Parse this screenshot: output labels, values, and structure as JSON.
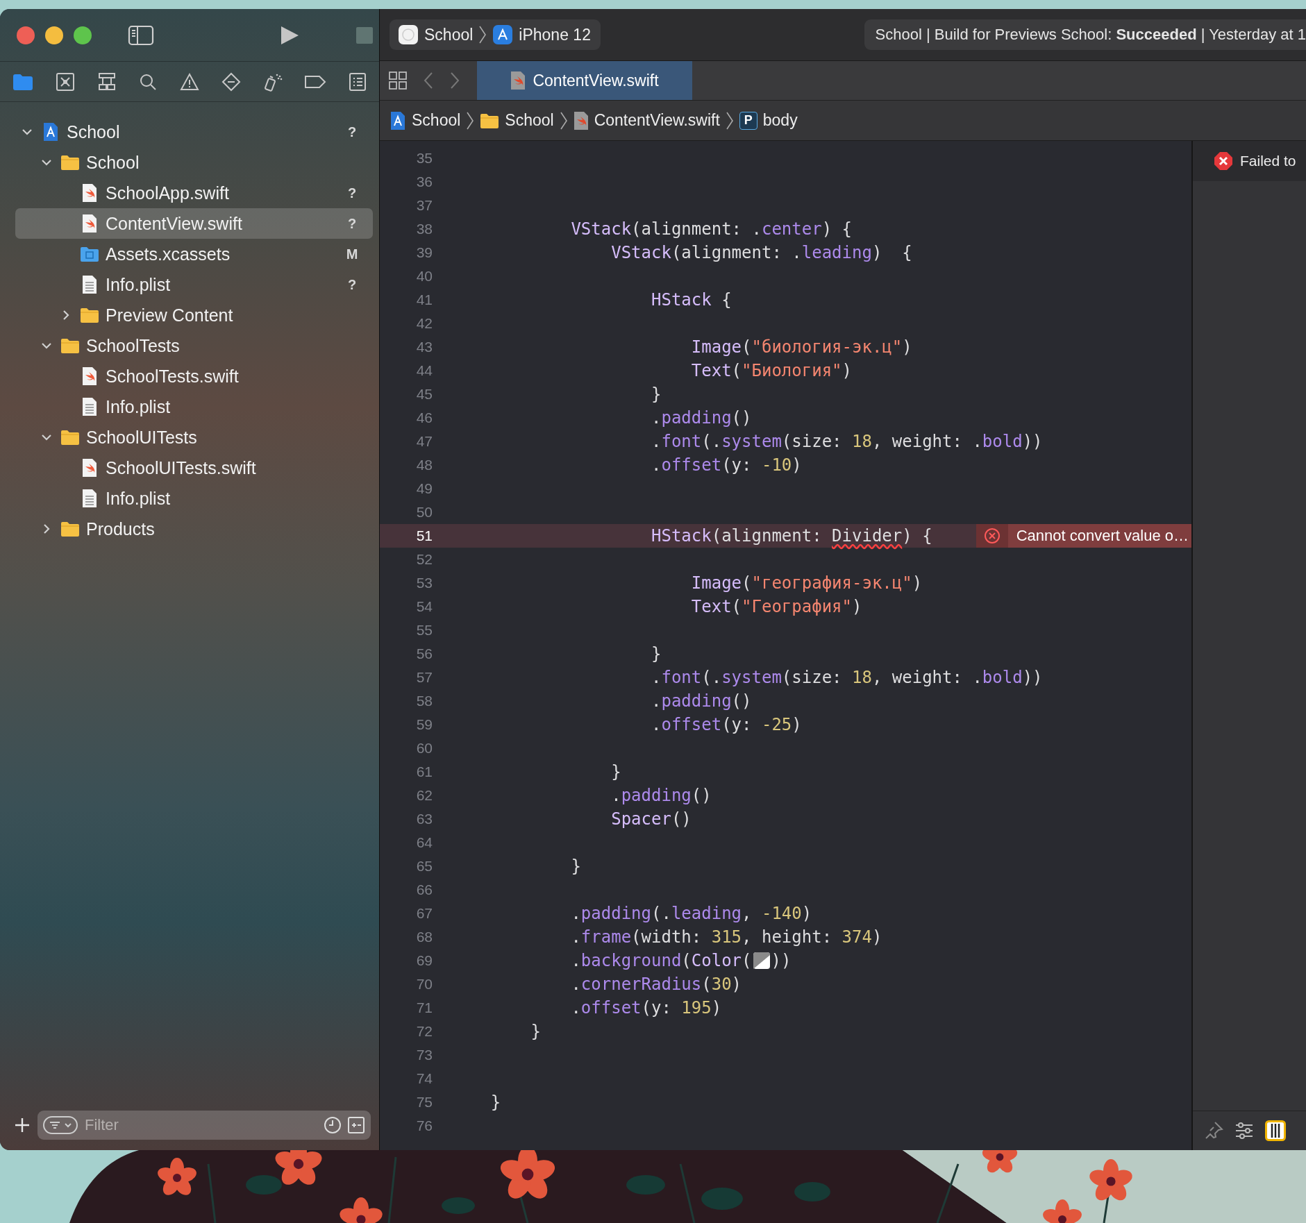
{
  "toolbar": {
    "scheme": {
      "project": "School",
      "device": "iPhone 12"
    },
    "status": "School | Build for Previews School: **Succeeded** | Yesterday at 1"
  },
  "navigator": {
    "tabs": [
      {
        "kind": "files",
        "selected": true
      },
      {
        "kind": "source_control",
        "selected": false
      },
      {
        "kind": "symbols",
        "selected": false
      },
      {
        "kind": "find",
        "selected": false
      },
      {
        "kind": "issues",
        "selected": false
      },
      {
        "kind": "tests",
        "selected": false
      },
      {
        "kind": "debug",
        "selected": false
      },
      {
        "kind": "breakpoints",
        "selected": false
      },
      {
        "kind": "reports",
        "selected": false
      }
    ],
    "tree": [
      {
        "kind": "project",
        "name": "School",
        "badge": "?",
        "expanded": true,
        "selected": false,
        "children": [
          {
            "kind": "folder",
            "name": "School",
            "expanded": true,
            "selected": false,
            "children": [
              {
                "kind": "swift",
                "name": "SchoolApp.swift",
                "badge": "?",
                "selected": false
              },
              {
                "kind": "swift",
                "name": "ContentView.swift",
                "badge": "?",
                "selected": true
              },
              {
                "kind": "assets",
                "name": "Assets.xcassets",
                "badge": "M",
                "selected": false
              },
              {
                "kind": "plist",
                "name": "Info.plist",
                "badge": "?",
                "selected": false
              },
              {
                "kind": "folder",
                "name": "Preview Content",
                "expanded": false,
                "selected": false
              }
            ]
          },
          {
            "kind": "folder",
            "name": "SchoolTests",
            "expanded": true,
            "selected": false,
            "children": [
              {
                "kind": "swift",
                "name": "SchoolTests.swift",
                "selected": false
              },
              {
                "kind": "plist",
                "name": "Info.plist",
                "selected": false
              }
            ]
          },
          {
            "kind": "folder",
            "name": "SchoolUITests",
            "expanded": true,
            "selected": false,
            "children": [
              {
                "kind": "swift",
                "name": "SchoolUITests.swift",
                "selected": false
              },
              {
                "kind": "plist",
                "name": "Info.plist",
                "selected": false
              }
            ]
          },
          {
            "kind": "folder",
            "name": "Products",
            "expanded": false,
            "selected": false
          }
        ]
      }
    ],
    "filter": {
      "placeholder": "Filter"
    }
  },
  "editor": {
    "tabs": [
      {
        "label": "ContentView.swift",
        "selected": true
      }
    ],
    "jump_bar": [
      {
        "kind": "project",
        "label": "School"
      },
      {
        "kind": "folder",
        "label": "School"
      },
      {
        "kind": "swift",
        "label": "ContentView.swift"
      },
      {
        "kind": "property",
        "symbol": "P",
        "label": "body"
      }
    ],
    "lines": [
      {
        "number": "35"
      },
      {
        "number": "36"
      },
      {
        "number": "37"
      },
      {
        "number": "38",
        "tokens": [
          {
            "kind": "type",
            "text": "            VStack"
          },
          {
            "kind": "plain",
            "text": "(alignment: ."
          },
          {
            "kind": "member",
            "text": "center"
          },
          {
            "kind": "plain",
            "text": ") {"
          }
        ]
      },
      {
        "number": "39",
        "tokens": [
          {
            "kind": "type",
            "text": "                VStack"
          },
          {
            "kind": "plain",
            "text": "(alignment: ."
          },
          {
            "kind": "member",
            "text": "leading"
          },
          {
            "kind": "plain",
            "text": ")  {"
          }
        ]
      },
      {
        "number": "40"
      },
      {
        "number": "41",
        "tokens": [
          {
            "kind": "type",
            "text": "                    HStack"
          },
          {
            "kind": "plain",
            "text": " {"
          }
        ]
      },
      {
        "number": "42"
      },
      {
        "number": "43",
        "tokens": [
          {
            "kind": "type",
            "text": "                        Image"
          },
          {
            "kind": "plain",
            "text": "("
          },
          {
            "kind": "string",
            "text": "\"биология-эк.ц\""
          },
          {
            "kind": "plain",
            "text": ")"
          }
        ]
      },
      {
        "number": "44",
        "tokens": [
          {
            "kind": "type",
            "text": "                        Text"
          },
          {
            "kind": "plain",
            "text": "("
          },
          {
            "kind": "string",
            "text": "\"Биология\""
          },
          {
            "kind": "plain",
            "text": ")"
          }
        ]
      },
      {
        "number": "45",
        "tokens": [
          {
            "kind": "plain",
            "text": "                    }"
          }
        ]
      },
      {
        "number": "46",
        "tokens": [
          {
            "kind": "plain",
            "text": "                    ."
          },
          {
            "kind": "member",
            "text": "padding"
          },
          {
            "kind": "plain",
            "text": "()"
          }
        ]
      },
      {
        "number": "47",
        "tokens": [
          {
            "kind": "plain",
            "text": "                    ."
          },
          {
            "kind": "member",
            "text": "font"
          },
          {
            "kind": "plain",
            "text": "(."
          },
          {
            "kind": "member",
            "text": "system"
          },
          {
            "kind": "plain",
            "text": "(size: "
          },
          {
            "kind": "number",
            "text": "18"
          },
          {
            "kind": "plain",
            "text": ", weight: ."
          },
          {
            "kind": "member",
            "text": "bold"
          },
          {
            "kind": "plain",
            "text": "))"
          }
        ]
      },
      {
        "number": "48",
        "tokens": [
          {
            "kind": "plain",
            "text": "                    ."
          },
          {
            "kind": "member",
            "text": "offset"
          },
          {
            "kind": "plain",
            "text": "(y: "
          },
          {
            "kind": "number",
            "text": "-10"
          },
          {
            "kind": "plain",
            "text": ")"
          }
        ]
      },
      {
        "number": "49"
      },
      {
        "number": "50"
      },
      {
        "number": "51",
        "error": "Cannot convert value o…",
        "tokens": [
          {
            "kind": "type",
            "text": "                    HStack"
          },
          {
            "kind": "plain",
            "text": "(alignment: "
          },
          {
            "kind": "error",
            "text": "Divider"
          },
          {
            "kind": "plain",
            "text": ") {"
          }
        ]
      },
      {
        "number": "52"
      },
      {
        "number": "53",
        "tokens": [
          {
            "kind": "type",
            "text": "                        Image"
          },
          {
            "kind": "plain",
            "text": "("
          },
          {
            "kind": "string",
            "text": "\"география-эк.ц\""
          },
          {
            "kind": "plain",
            "text": ")"
          }
        ]
      },
      {
        "number": "54",
        "tokens": [
          {
            "kind": "type",
            "text": "                        Text"
          },
          {
            "kind": "plain",
            "text": "("
          },
          {
            "kind": "string",
            "text": "\"География\""
          },
          {
            "kind": "plain",
            "text": ")"
          }
        ]
      },
      {
        "number": "55"
      },
      {
        "number": "56",
        "tokens": [
          {
            "kind": "plain",
            "text": "                    }"
          }
        ]
      },
      {
        "number": "57",
        "tokens": [
          {
            "kind": "plain",
            "text": "                    ."
          },
          {
            "kind": "member",
            "text": "font"
          },
          {
            "kind": "plain",
            "text": "(."
          },
          {
            "kind": "member",
            "text": "system"
          },
          {
            "kind": "plain",
            "text": "(size: "
          },
          {
            "kind": "number",
            "text": "18"
          },
          {
            "kind": "plain",
            "text": ", weight: ."
          },
          {
            "kind": "member",
            "text": "bold"
          },
          {
            "kind": "plain",
            "text": "))"
          }
        ]
      },
      {
        "number": "58",
        "tokens": [
          {
            "kind": "plain",
            "text": "                    ."
          },
          {
            "kind": "member",
            "text": "padding"
          },
          {
            "kind": "plain",
            "text": "()"
          }
        ]
      },
      {
        "number": "59",
        "tokens": [
          {
            "kind": "plain",
            "text": "                    ."
          },
          {
            "kind": "member",
            "text": "offset"
          },
          {
            "kind": "plain",
            "text": "(y: "
          },
          {
            "kind": "number",
            "text": "-25"
          },
          {
            "kind": "plain",
            "text": ")"
          }
        ]
      },
      {
        "number": "60"
      },
      {
        "number": "61",
        "tokens": [
          {
            "kind": "plain",
            "text": "                }"
          }
        ]
      },
      {
        "number": "62",
        "tokens": [
          {
            "kind": "plain",
            "text": "                ."
          },
          {
            "kind": "member",
            "text": "padding"
          },
          {
            "kind": "plain",
            "text": "()"
          }
        ]
      },
      {
        "number": "63",
        "tokens": [
          {
            "kind": "type",
            "text": "                Spacer"
          },
          {
            "kind": "plain",
            "text": "()"
          }
        ]
      },
      {
        "number": "64"
      },
      {
        "number": "65",
        "tokens": [
          {
            "kind": "plain",
            "text": "            }"
          }
        ]
      },
      {
        "number": "66"
      },
      {
        "number": "67",
        "tokens": [
          {
            "kind": "plain",
            "text": "            ."
          },
          {
            "kind": "member",
            "text": "padding"
          },
          {
            "kind": "plain",
            "text": "(."
          },
          {
            "kind": "member",
            "text": "leading"
          },
          {
            "kind": "plain",
            "text": ", "
          },
          {
            "kind": "number",
            "text": "-140"
          },
          {
            "kind": "plain",
            "text": ")"
          }
        ]
      },
      {
        "number": "68",
        "tokens": [
          {
            "kind": "plain",
            "text": "            ."
          },
          {
            "kind": "member",
            "text": "frame"
          },
          {
            "kind": "plain",
            "text": "(width: "
          },
          {
            "kind": "number",
            "text": "315"
          },
          {
            "kind": "plain",
            "text": ", height: "
          },
          {
            "kind": "number",
            "text": "374"
          },
          {
            "kind": "plain",
            "text": ")"
          }
        ]
      },
      {
        "number": "69",
        "tokens": [
          {
            "kind": "plain",
            "text": "            ."
          },
          {
            "kind": "member",
            "text": "background"
          },
          {
            "kind": "plain",
            "text": "("
          },
          {
            "kind": "type",
            "text": "Color"
          },
          {
            "kind": "plain",
            "text": "("
          },
          {
            "kind": "swatch"
          },
          {
            "kind": "plain",
            "text": "))"
          }
        ]
      },
      {
        "number": "70",
        "tokens": [
          {
            "kind": "plain",
            "text": "            ."
          },
          {
            "kind": "member",
            "text": "cornerRadius"
          },
          {
            "kind": "plain",
            "text": "("
          },
          {
            "kind": "number",
            "text": "30"
          },
          {
            "kind": "plain",
            "text": ")"
          }
        ]
      },
      {
        "number": "71",
        "tokens": [
          {
            "kind": "plain",
            "text": "            ."
          },
          {
            "kind": "member",
            "text": "offset"
          },
          {
            "kind": "plain",
            "text": "(y: "
          },
          {
            "kind": "number",
            "text": "195"
          },
          {
            "kind": "plain",
            "text": ")"
          }
        ]
      },
      {
        "number": "72",
        "tokens": [
          {
            "kind": "plain",
            "text": "        }"
          }
        ]
      },
      {
        "number": "73"
      },
      {
        "number": "74"
      },
      {
        "number": "75",
        "tokens": [
          {
            "kind": "plain",
            "text": "    }"
          }
        ]
      },
      {
        "number": "76"
      }
    ]
  },
  "inspector": {
    "message": "Failed to"
  }
}
